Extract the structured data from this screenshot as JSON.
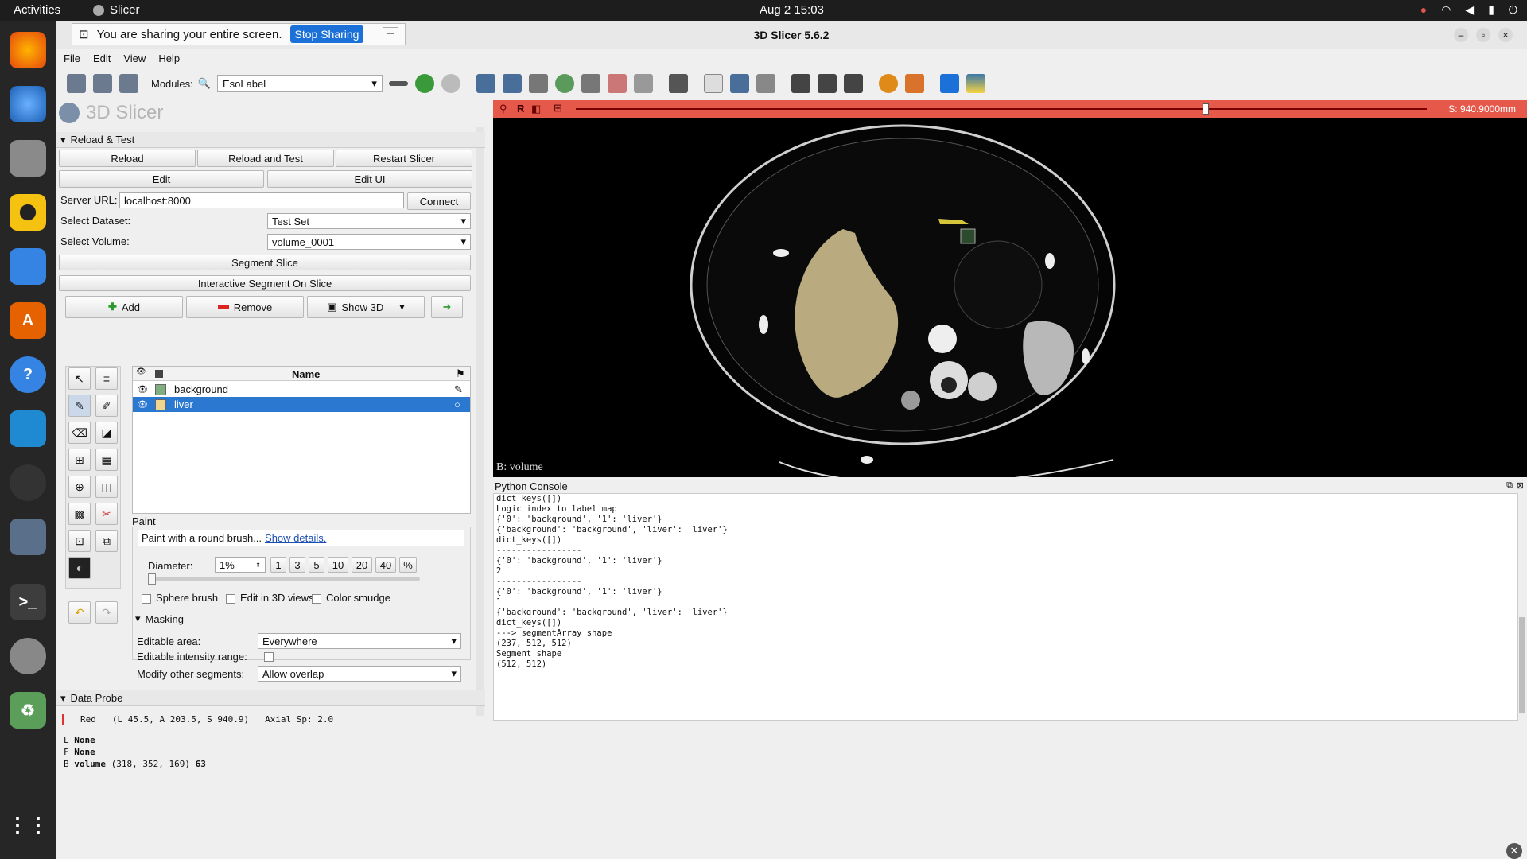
{
  "topbar": {
    "activities": "Activities",
    "app_name": "Slicer",
    "datetime": "Aug 2  15:03"
  },
  "window": {
    "title": "3D Slicer 5.6.2"
  },
  "share_banner": {
    "text": "You are sharing your entire screen.",
    "stop_label": "Stop Sharing",
    "minimize_label": "–"
  },
  "menu": {
    "file": "File",
    "edit": "Edit",
    "view": "View",
    "help": "Help"
  },
  "toolbar": {
    "modules_label": "Modules:",
    "module_value": "EsoLabel"
  },
  "panel": {
    "logo": "3D Slicer",
    "reload_section": "Reload & Test",
    "reload": "Reload",
    "reload_test": "Reload and Test",
    "restart": "Restart Slicer",
    "edit": "Edit",
    "edit_ui": "Edit UI",
    "server_label": "Server URL:",
    "server_value": "localhost:8000",
    "connect": "Connect",
    "dataset_label": "Select Dataset:",
    "dataset_value": "Test Set",
    "volume_label": "Select Volume:",
    "volume_value": "volume_0001",
    "segment_slice": "Segment Slice",
    "interactive": "Interactive Segment On Slice",
    "add": "Add",
    "remove": "Remove",
    "show3d": "Show 3D",
    "col_name": "Name",
    "segments": [
      {
        "name": "background",
        "color": "#80ae80"
      },
      {
        "name": "liver",
        "color": "#f1d691"
      }
    ],
    "paint_title": "Paint",
    "paint_desc": "Paint with a round brush...",
    "show_details": "Show details.",
    "diameter_label": "Diameter:",
    "diameter_value": "1%",
    "presets": [
      "1",
      "3",
      "5",
      "10",
      "20",
      "40",
      "%"
    ],
    "sphere": "Sphere brush",
    "edit3d": "Edit in 3D views",
    "smudge": "Color smudge",
    "masking": "Masking",
    "editable_area_label": "Editable area:",
    "editable_area_value": "Everywhere",
    "intensity_label": "Editable intensity range:",
    "modify_label": "Modify other segments:",
    "modify_value": "Allow overlap",
    "probe_title": "Data Probe",
    "probe_view": "Red",
    "probe_coords": "(L 45.5, A 203.5, S 940.9)",
    "probe_axial": "Axial Sp: 2.0",
    "probe_L": "L",
    "probe_L_val": "None",
    "probe_F": "F",
    "probe_F_val": "None",
    "probe_B": "B",
    "probe_B_name": "volume",
    "probe_B_ijk": "(318, 352, 169)",
    "probe_B_val": "63"
  },
  "viewer": {
    "view_letter": "R",
    "slice_offset": "S: 940.9000mm",
    "slider_fraction": 0.74,
    "bottom_label": "B: volume"
  },
  "console": {
    "title": "Python Console",
    "lines": [
      "dict_keys([])",
      "Logic index to label map",
      "{'0': 'background', '1': 'liver'}",
      "{'background': 'background', 'liver': 'liver'}",
      "dict_keys([])",
      "-----------------",
      "{'0': 'background', '1': 'liver'}",
      "2",
      "-----------------",
      "{'0': 'background', '1': 'liver'}",
      "1",
      "{'background': 'background', 'liver': 'liver'}",
      "dict_keys([])",
      "---> segmentArray shape",
      "(237, 512, 512)",
      "Segment shape",
      "(512, 512)"
    ]
  }
}
